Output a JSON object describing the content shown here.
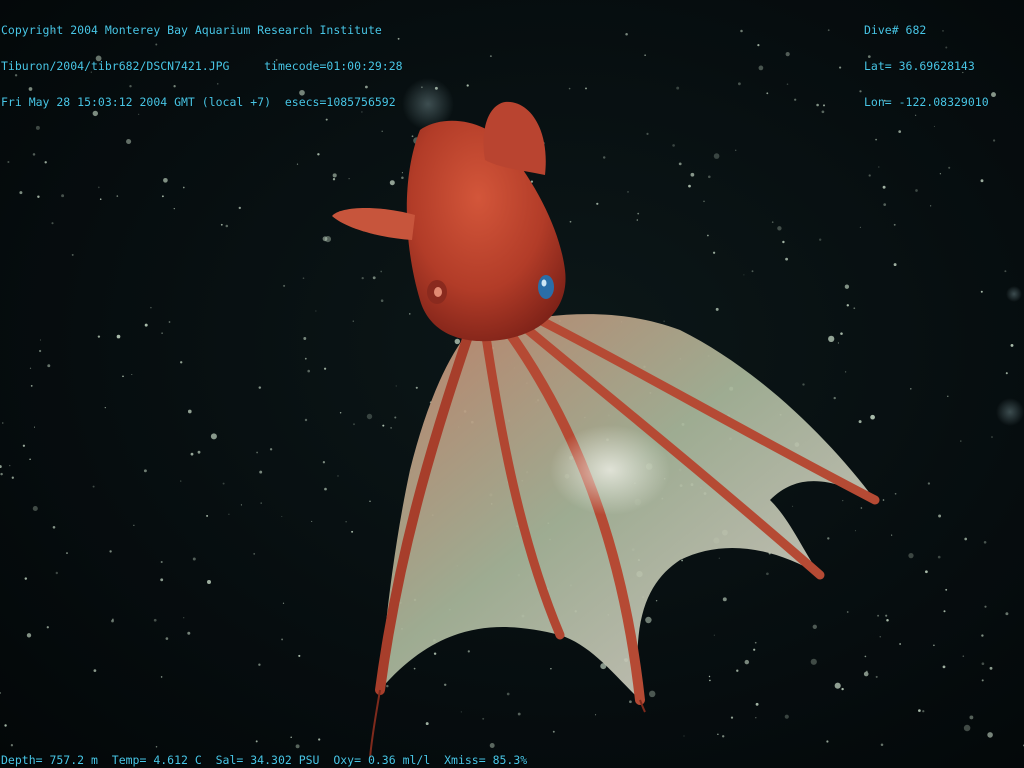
{
  "overlay": {
    "top_left": [
      "Copyright 2004 Monterey Bay Aquarium Research Institute",
      "Tiburon/2004/tibr682/DSCN7421.JPG     timecode=01:00:29:28",
      "Fri May 28 15:03:12 2004 GMT (local +7)  esecs=1085756592"
    ],
    "top_right": [
      "Dive# 682",
      "Lat= 36.69628143",
      "Lon= -122.08329010"
    ],
    "bottom": "Depth= 757.2 m  Temp= 4.612 C  Sal= 34.302 PSU  Oxy= 0.36 ml/l  Xmiss= 85.3%",
    "text_color": "#48c6e6"
  },
  "scene": {
    "subject": "red-octopus-like-deep-sea-creature",
    "background_color": "#050b0d",
    "body_color": "#b8412c",
    "web_color": "#a7b59a"
  }
}
